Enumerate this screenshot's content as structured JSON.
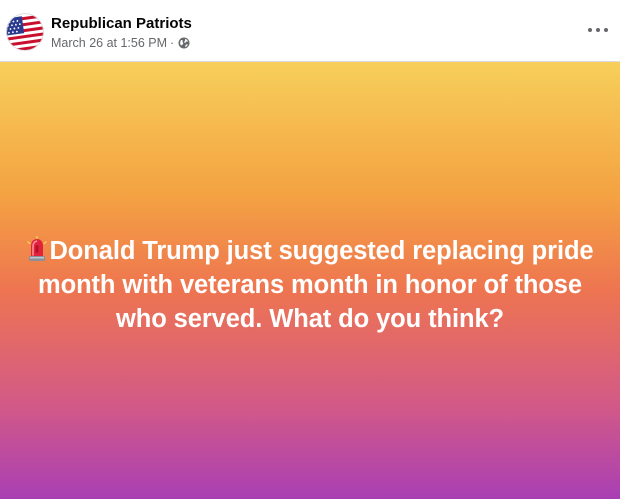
{
  "post": {
    "page_name": "Republican Patriots",
    "timestamp": "March 26 at 1:56 PM",
    "separator": "·",
    "audience_icon": "globe-icon",
    "more_icon": "more-options-icon",
    "status_emoji": "police-light-icon",
    "status_text": "Donald Trump just suggested replacing pride month with veterans month in honor of those who served. What do you think?"
  },
  "colors": {
    "gradient_top": "#f7cf5a",
    "gradient_middle": "#ee7550",
    "gradient_bottom": "#a93fb4",
    "name_text": "#050505",
    "meta_text": "#65676b"
  }
}
